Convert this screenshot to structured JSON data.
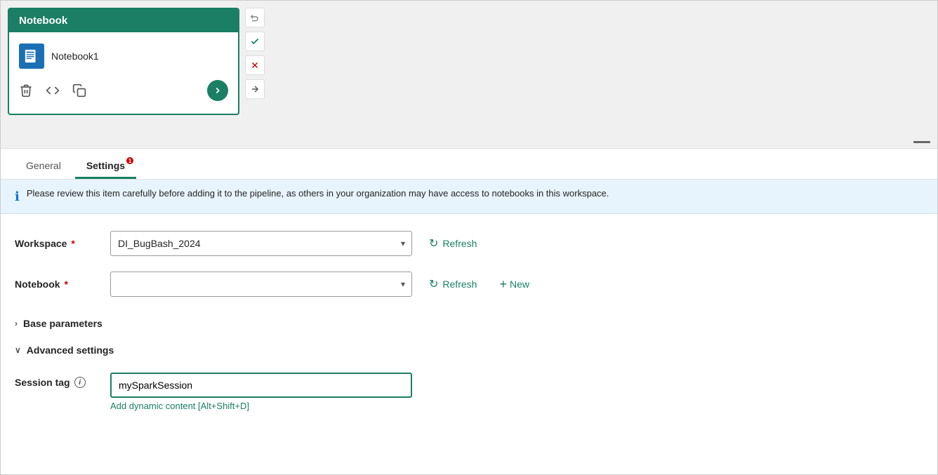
{
  "notebook_card": {
    "header": "Notebook",
    "item_name": "Notebook1",
    "actions": {
      "delete_label": "delete",
      "code_label": "code",
      "copy_label": "copy",
      "go_label": "go"
    }
  },
  "sidebar_buttons": {
    "undo": "↩",
    "check": "✓",
    "close": "✕",
    "arrow_right": "→"
  },
  "tabs": [
    {
      "id": "general",
      "label": "General",
      "active": false,
      "badge": null
    },
    {
      "id": "settings",
      "label": "Settings",
      "active": true,
      "badge": "1"
    }
  ],
  "info_banner": {
    "text": "Please review this item carefully before adding it to the pipeline, as others in your organization may have access to notebooks in this workspace."
  },
  "form": {
    "workspace": {
      "label": "Workspace",
      "required": true,
      "value": "DI_BugBash_2024",
      "placeholder": "",
      "refresh_label": "Refresh"
    },
    "notebook": {
      "label": "Notebook",
      "required": true,
      "value": "",
      "placeholder": "",
      "refresh_label": "Refresh",
      "new_label": "New"
    },
    "base_parameters": {
      "label": "Base parameters",
      "collapsed": true,
      "chevron": "›"
    },
    "advanced_settings": {
      "label": "Advanced settings",
      "collapsed": false,
      "chevron": "∨"
    },
    "session_tag": {
      "label": "Session tag",
      "value": "mySparkSession",
      "dynamic_content_link": "Add dynamic content [Alt+Shift+D]"
    }
  },
  "colors": {
    "teal": "#1a7f64",
    "red": "#c00000",
    "blue": "#0078d4",
    "notebook_blue": "#1a6fb5"
  }
}
